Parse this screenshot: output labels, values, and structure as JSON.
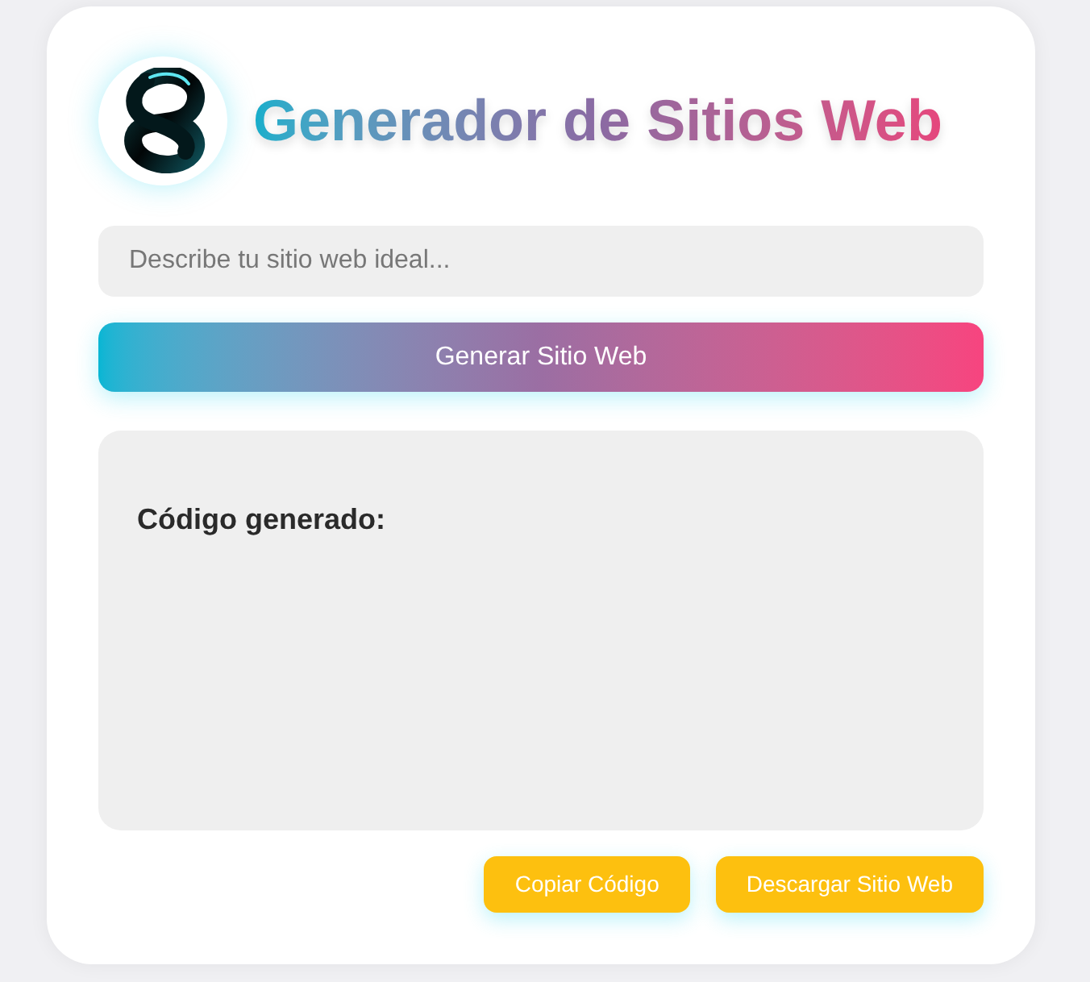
{
  "header": {
    "title": "Generador de Sitios Web"
  },
  "prompt": {
    "placeholder": "Describe tu sitio web ideal..."
  },
  "generate_button": "Generar Sitio Web",
  "output": {
    "heading": "Código generado:"
  },
  "actions": [
    "Copiar Código",
    "Descargar Sitio Web"
  ]
}
